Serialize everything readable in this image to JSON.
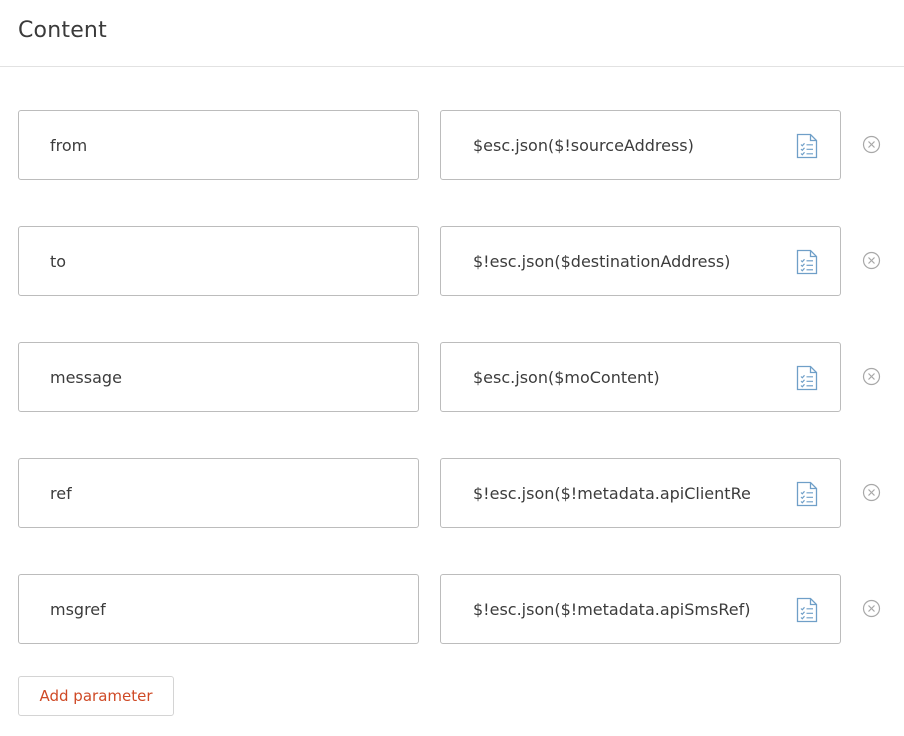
{
  "section": {
    "title": "Content"
  },
  "params": [
    {
      "key": "from",
      "value": "$esc.json($!sourceAddress)"
    },
    {
      "key": "to",
      "value": "$!esc.json($destinationAddress)"
    },
    {
      "key": "message",
      "value": "$esc.json($moContent)"
    },
    {
      "key": "ref",
      "value": "$!esc.json($!metadata.apiClientRe"
    },
    {
      "key": "msgref",
      "value": "$!esc.json($!metadata.apiSmsRef)"
    }
  ],
  "icons": {
    "value_action": "document-list-icon",
    "remove": "close-circle-icon"
  },
  "colors": {
    "accent": "#cf4a26",
    "icon": "#6f9fc8",
    "border": "#bcbcbc"
  },
  "add_button": {
    "label": "Add parameter"
  }
}
